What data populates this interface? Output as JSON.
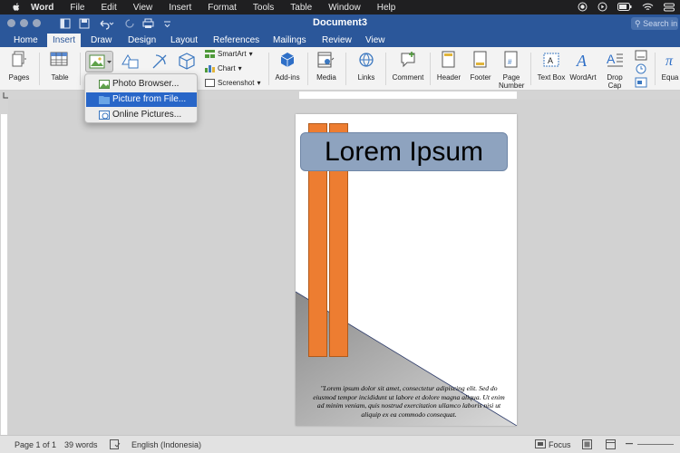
{
  "macmenu": {
    "app": "Word",
    "items": [
      "File",
      "Edit",
      "View",
      "Insert",
      "Format",
      "Tools",
      "Table",
      "Window",
      "Help"
    ]
  },
  "window": {
    "title": "Document3",
    "search_placeholder": "Search in"
  },
  "tabs": [
    "Home",
    "Insert",
    "Draw",
    "Design",
    "Layout",
    "References",
    "Mailings",
    "Review",
    "View"
  ],
  "ribbon": {
    "pages": "Pages",
    "table": "Table",
    "smartart": "SmartArt",
    "chart": "Chart",
    "screenshot": "Screenshot",
    "addins": "Add-ins",
    "media": "Media",
    "links": "Links",
    "comment": "Comment",
    "header": "Header",
    "footer": "Footer",
    "page_number": "Page Number",
    "text_box": "Text Box",
    "wordart": "WordArt",
    "drop_cap": "Drop Cap",
    "equation": "Equa"
  },
  "picture_menu": {
    "items": [
      "Photo Browser...",
      "Picture from File...",
      "Online Pictures..."
    ],
    "selected": "Picture from File..."
  },
  "document": {
    "title": "Lorem Ipsum",
    "quote": "\"Lorem ipsum dolor sit amet, consectetur adipiscing elit. Sed do eiusmod tempor incididunt ut labore et dolore magna aliqua. Ut enim ad minim veniam, quis nostrud exercitation ullamco laboris nisi ut aliquip ex ea commodo consequat."
  },
  "status": {
    "page": "Page 1 of 1",
    "words": "39 words",
    "language": "English (Indonesia)",
    "focus": "Focus"
  },
  "colors": {
    "accent": "#2b579a",
    "orange_bar": "#ed7d31",
    "title_box": "#8ea3bf",
    "menu_selected": "#2866c8"
  }
}
